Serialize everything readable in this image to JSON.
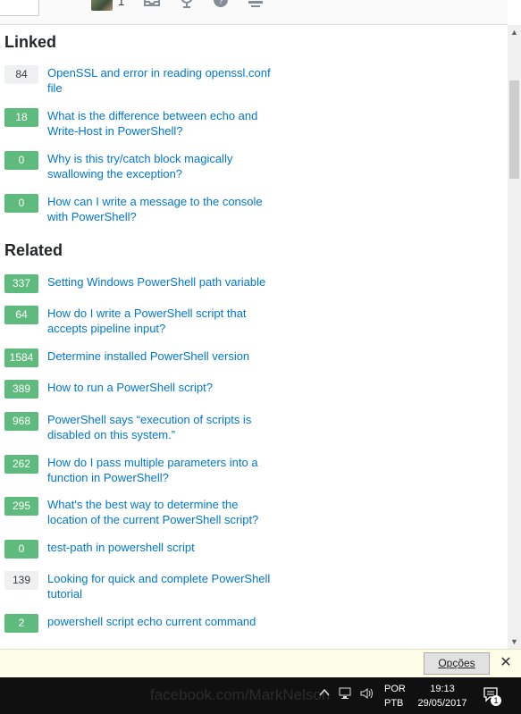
{
  "header": {
    "reputation": "1"
  },
  "linked": {
    "title": "Linked",
    "items": [
      {
        "score": "84",
        "answered": false,
        "title": "OpenSSL and error in reading openssl.conf file"
      },
      {
        "score": "18",
        "answered": true,
        "title": "What is the difference between echo and Write-Host in PowerShell?"
      },
      {
        "score": "0",
        "answered": true,
        "title": "Why is this try/catch block magically swallowing the exception?"
      },
      {
        "score": "0",
        "answered": true,
        "title": "How can I write a message to the console with PowerShell?"
      }
    ]
  },
  "related": {
    "title": "Related",
    "items": [
      {
        "score": "337",
        "answered": true,
        "title": "Setting Windows PowerShell path variable"
      },
      {
        "score": "64",
        "answered": true,
        "title": "How do I write a PowerShell script that accepts pipeline input?"
      },
      {
        "score": "1584",
        "answered": true,
        "title": "Determine installed PowerShell version"
      },
      {
        "score": "389",
        "answered": true,
        "title": "How to run a PowerShell script?"
      },
      {
        "score": "968",
        "answered": true,
        "title": "PowerShell says “execution of scripts is disabled on this system.”"
      },
      {
        "score": "262",
        "answered": true,
        "title": "How do I pass multiple parameters into a function in PowerShell?"
      },
      {
        "score": "295",
        "answered": true,
        "title": "What's the best way to determine the location of the current PowerShell script?"
      },
      {
        "score": "0",
        "answered": true,
        "title": "test-path in powershell script"
      },
      {
        "score": "139",
        "answered": false,
        "title": "Looking for quick and complete PowerShell tutorial"
      },
      {
        "score": "2",
        "answered": true,
        "title": "powershell script echo current command"
      }
    ]
  },
  "notification_bar": {
    "options_label": "Opções",
    "close_label": "✕"
  },
  "taskbar": {
    "watermark": "facebook.com/MarkNelson",
    "lang_primary": "POR",
    "lang_secondary": "PTB",
    "time": "19:13",
    "date": "29/05/2017",
    "notification_count": "1"
  }
}
